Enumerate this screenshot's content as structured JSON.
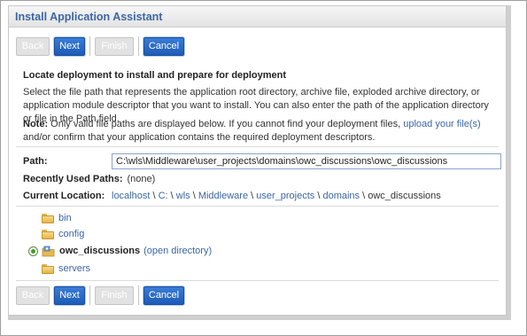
{
  "window": {
    "title": "Install Application Assistant"
  },
  "buttons": {
    "back": "Back",
    "next": "Next",
    "finish": "Finish",
    "cancel": "Cancel"
  },
  "content": {
    "heading": "Locate deployment to install and prepare for deployment",
    "description": "Select the file path that represents the application root directory, archive file, exploded archive directory, or application module descriptor that you want to install. You can also enter the path of the application directory or file in the Path field.",
    "note_label": "Note:",
    "note_before_link": " Only valid file paths are displayed below. If you cannot find your deployment files, ",
    "note_link": "upload your file(s)",
    "note_after_link": " and/or confirm that your application contains the required deployment descriptors."
  },
  "fields": {
    "path_label": "Path:",
    "path_value": "C:\\wls\\Middleware\\user_projects\\domains\\owc_discussions\\owc_discussions",
    "recent_label": "Recently Used Paths:",
    "recent_value": "(none)",
    "location_label": "Current Location:",
    "location_crumbs": [
      {
        "text": "localhost",
        "link": true
      },
      {
        "text": " \\ ",
        "link": false
      },
      {
        "text": "C:",
        "link": true
      },
      {
        "text": " \\ ",
        "link": false
      },
      {
        "text": "wls",
        "link": true
      },
      {
        "text": " \\ ",
        "link": false
      },
      {
        "text": "Middleware",
        "link": true
      },
      {
        "text": " \\ ",
        "link": false
      },
      {
        "text": "user_projects",
        "link": true
      },
      {
        "text": " \\ ",
        "link": false
      },
      {
        "text": "domains",
        "link": true
      },
      {
        "text": " \\ ",
        "link": false
      },
      {
        "text": "owc_discussions",
        "link": false
      }
    ]
  },
  "tree": {
    "items": [
      {
        "label": "bin",
        "type": "folder",
        "icon": "folder-icon"
      },
      {
        "label": "config",
        "type": "folder",
        "icon": "folder-icon"
      },
      {
        "label": "owc_discussions",
        "type": "application",
        "icon": "application-icon",
        "selected": true,
        "action": "(open directory)"
      },
      {
        "label": "servers",
        "type": "folder",
        "icon": "folder-icon"
      }
    ]
  },
  "colors": {
    "title": "#3a66a6",
    "link": "#3a66a6",
    "button_enabled": "#1d5bb8",
    "button_disabled": "#e2e2e2"
  }
}
